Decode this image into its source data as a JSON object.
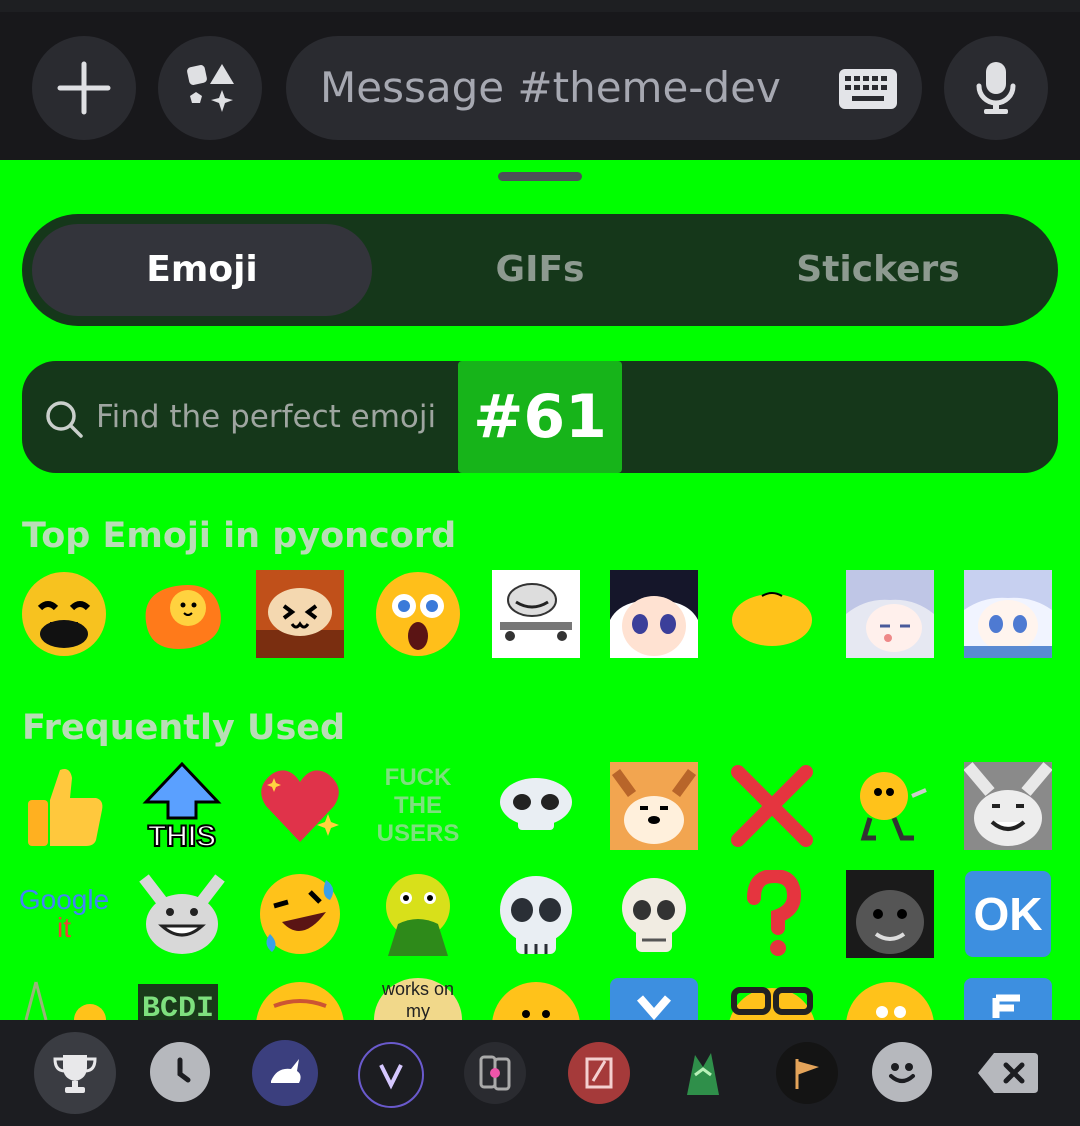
{
  "composer": {
    "placeholder": "Message #theme-dev",
    "add_icon": "plus-icon",
    "apps_icon": "shapes-icon",
    "keyboard_icon": "keyboard-icon",
    "mic_icon": "microphone-icon"
  },
  "picker": {
    "tabs": [
      {
        "label": "Emoji",
        "active": true
      },
      {
        "label": "GIFs",
        "active": false
      },
      {
        "label": "Stickers",
        "active": false
      }
    ],
    "search_placeholder": "Find the perfect emoji",
    "overlay_badge": "#61"
  },
  "sections": [
    {
      "title": "Top Emoji in pyoncord"
    },
    {
      "title": "Frequently Used"
    }
  ],
  "emoji_text": {
    "this": "THIS",
    "ftu_1": "FUCK",
    "ftu_2": "THE",
    "ftu_3": "USERS",
    "google": "Google",
    "it": "it",
    "ok": "OK",
    "works": "works on",
    "my": "my"
  },
  "bottom_categories": [
    "trophy-icon",
    "clock-icon",
    "server-rabbit-icon",
    "server-v-icon",
    "server-phones-icon",
    "server-red-icon",
    "server-green-icon",
    "server-flag-icon",
    "smiley-icon",
    "backspace-icon"
  ],
  "colors": {
    "panel_bg": "#00ff00",
    "pill_bg": "#15371a",
    "active_tab": "#33343b",
    "badge": "#17b41a"
  }
}
